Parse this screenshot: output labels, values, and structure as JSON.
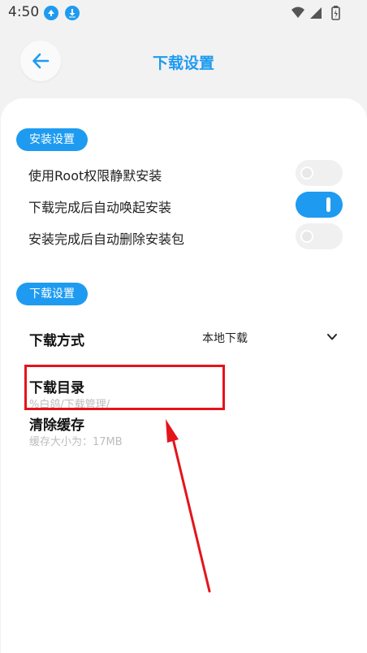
{
  "status_bar": {
    "time": "4:50",
    "notification_icons": [
      "app-icon",
      "download-icon"
    ],
    "system_icons": [
      "wifi-icon",
      "signal-icon",
      "battery-charging-icon"
    ]
  },
  "header": {
    "title": "下载设置",
    "back_icon": "arrow-left-icon"
  },
  "install_section": {
    "label": "安装设置",
    "items": [
      {
        "label": "使用Root权限静默安装",
        "enabled": false
      },
      {
        "label": "下载完成后自动唤起安装",
        "enabled": true
      },
      {
        "label": "安装完成后自动删除安装包",
        "enabled": false
      }
    ]
  },
  "download_section": {
    "label": "下载设置",
    "method": {
      "title": "下载方式",
      "value": "本地下载"
    },
    "directory": {
      "title": "下载目录",
      "path": "%白鸽/下载管理/"
    },
    "cache": {
      "title": "清除缓存",
      "size_text": "缓存大小为：17MB"
    }
  },
  "colors": {
    "accent": "#1e9bf0",
    "annotation": "#e4141b",
    "background": "#f2f2f2",
    "card": "#ffffff"
  }
}
